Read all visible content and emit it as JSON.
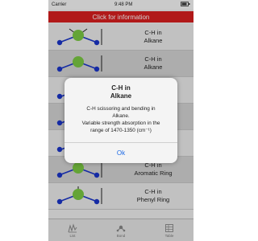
{
  "status_bar": {
    "carrier": "Carrier",
    "time": "9:48 PM",
    "battery": ""
  },
  "banner": {
    "label": "Click for information"
  },
  "rows": [
    {
      "line1": "C-H in",
      "line2": "Alkane"
    },
    {
      "line1": "C-H in",
      "line2": "Alkane"
    },
    {
      "line1": "",
      "line2": ""
    },
    {
      "line1": "",
      "line2": ""
    },
    {
      "line1": "",
      "line2": ""
    },
    {
      "line1": "C-H in",
      "line2": "Aromatic Ring"
    },
    {
      "line1": "C-H in",
      "line2": "Phenyl Ring"
    }
  ],
  "dialog": {
    "title_line1": "C-H in",
    "title_line2": "Alkane",
    "message_line1": "C-H scissoring and bending in",
    "message_line2": "Alkane.",
    "message_line3": "Variable strength absorption in the",
    "message_line4": "range of 1470-1350 (cm⁻¹)",
    "ok_label": "Ok"
  },
  "tabs": [
    {
      "label": "List",
      "icon": "spectrum-icon"
    },
    {
      "label": "Bond",
      "icon": "molecule-icon"
    },
    {
      "label": "Table",
      "icon": "table-icon"
    }
  ],
  "colors": {
    "banner": "#d81f1f",
    "atom_green": "#7ac943",
    "atom_blue": "#1a35c8",
    "ok_blue": "#1e6be6"
  }
}
